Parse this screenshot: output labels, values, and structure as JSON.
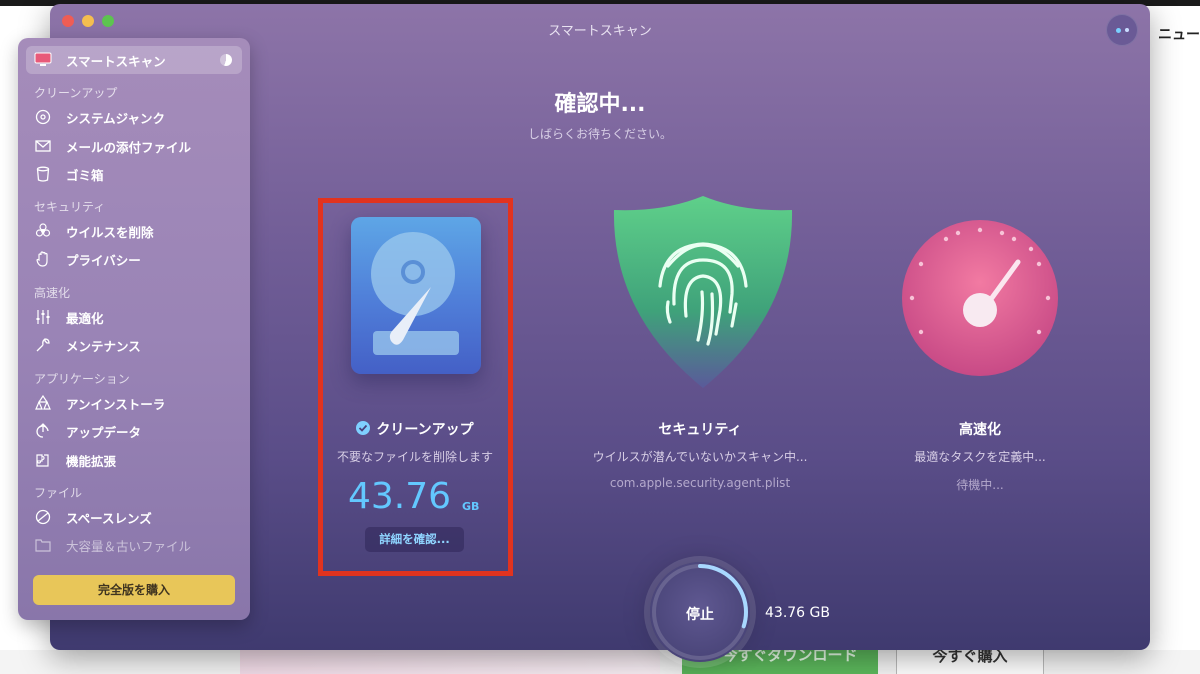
{
  "background_page": {
    "right_text": "ニュー",
    "green_button": "今すぐダウンロード",
    "white_button": "今すぐ購入"
  },
  "window": {
    "title": "スマートスキャン"
  },
  "main": {
    "title": "確認中...",
    "subtitle": "しばらくお待ちください。"
  },
  "sidebar": {
    "active_item": "スマートスキャン",
    "sections": [
      {
        "label": "クリーンアップ",
        "items": [
          "システムジャンク",
          "メールの添付ファイル",
          "ゴミ箱"
        ]
      },
      {
        "label": "セキュリティ",
        "items": [
          "ウイルスを削除",
          "プライバシー"
        ]
      },
      {
        "label": "高速化",
        "items": [
          "最適化",
          "メンテナンス"
        ]
      },
      {
        "label": "アプリケーション",
        "items": [
          "アンインストーラ",
          "アップデータ",
          "機能拡張"
        ]
      },
      {
        "label": "ファイル",
        "items": [
          "スペースレンズ",
          "大容量＆古いファイル"
        ]
      }
    ],
    "buy_button": "完全版を購入"
  },
  "modules": {
    "cleanup": {
      "name": "クリーンアップ",
      "description": "不要なファイルを削除します",
      "size_value": "43.76",
      "size_unit": "GB",
      "details_button": "詳細を確認..."
    },
    "security": {
      "name": "セキュリティ",
      "description": "ウイルスが潜んでいないかスキャン中...",
      "status": "com.apple.security.agent.plist"
    },
    "speed": {
      "name": "高速化",
      "description": "最適なタスクを定義中...",
      "status": "待機中..."
    }
  },
  "controls": {
    "stop_button": "停止",
    "scan_size": "43.76 GB",
    "progress": 0.3
  },
  "colors": {
    "accent_blue": "#63c8ff",
    "buy_button": "#e8c659",
    "highlight_box": "#e1331f"
  }
}
